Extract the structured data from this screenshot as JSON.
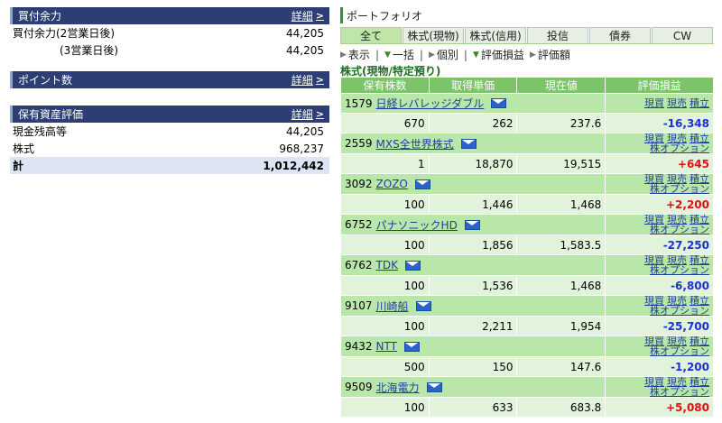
{
  "left": {
    "buying_power": {
      "title": "買付余力",
      "more": "詳細",
      "rows": [
        {
          "label": "買付余力(2営業日後)",
          "value": "44,205"
        },
        {
          "label": "(3営業日後)",
          "value": "44,205"
        }
      ]
    },
    "points": {
      "title": "ポイント数",
      "more": "詳細"
    },
    "assets": {
      "title": "保有資産評価",
      "more": "詳細",
      "rows": [
        {
          "label": "現金残高等",
          "value": "44,205"
        },
        {
          "label": "株式",
          "value": "968,237"
        }
      ],
      "total": {
        "label": "計",
        "value": "1,012,442"
      }
    }
  },
  "right": {
    "title": "ポートフォリオ",
    "tabs": [
      "全て",
      "株式(現物)",
      "株式(信用)",
      "投信",
      "債券",
      "CW"
    ],
    "toolbar": {
      "display": "表示",
      "bulk": "一括",
      "individual": "個別",
      "pl": "評価損益",
      "pl_amount": "評価額",
      "sep": "|"
    },
    "section": "株式(現物/特定預り)",
    "columns": [
      "保有株数",
      "取得単価",
      "現在値",
      "評価損益"
    ],
    "link_labels": {
      "buy": "現買",
      "sell": "現売",
      "tsumitate": "積立",
      "option": "株オプション"
    },
    "holdings": [
      {
        "code": "1579",
        "name": "日経レバレッジダブル",
        "qty": "670",
        "cost": "262",
        "price": "237.6",
        "pl": "-16,348",
        "sign": "neg",
        "option": false
      },
      {
        "code": "2559",
        "name": "MXS全世界株式",
        "qty": "1",
        "cost": "18,870",
        "price": "19,515",
        "pl": "+645",
        "sign": "pos",
        "option": true
      },
      {
        "code": "3092",
        "name": "ZOZO",
        "qty": "100",
        "cost": "1,446",
        "price": "1,468",
        "pl": "+2,200",
        "sign": "pos",
        "option": true
      },
      {
        "code": "6752",
        "name": "パナソニックHD",
        "qty": "100",
        "cost": "1,856",
        "price": "1,583.5",
        "pl": "-27,250",
        "sign": "neg",
        "option": true
      },
      {
        "code": "6762",
        "name": "TDK",
        "qty": "100",
        "cost": "1,536",
        "price": "1,468",
        "pl": "-6,800",
        "sign": "neg",
        "option": true
      },
      {
        "code": "9107",
        "name": "川崎船",
        "qty": "100",
        "cost": "2,211",
        "price": "1,954",
        "pl": "-25,700",
        "sign": "neg",
        "option": true
      },
      {
        "code": "9432",
        "name": "NTT",
        "qty": "500",
        "cost": "150",
        "price": "147.6",
        "pl": "-1,200",
        "sign": "neg",
        "option": true
      },
      {
        "code": "9509",
        "name": "北海電力",
        "qty": "100",
        "cost": "633",
        "price": "683.8",
        "pl": "+5,080",
        "sign": "pos",
        "option": true
      }
    ]
  }
}
